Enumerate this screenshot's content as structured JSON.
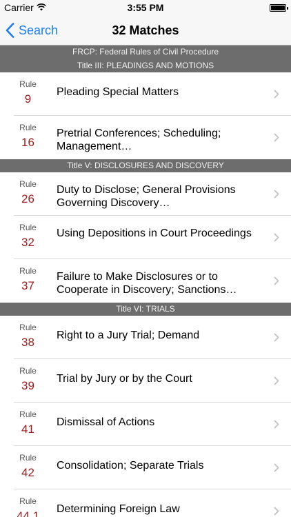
{
  "status_bar": {
    "carrier": "Carrier",
    "time": "3:55 PM",
    "battery_level": 1.0
  },
  "nav": {
    "back_label": "Search",
    "title": "32 Matches"
  },
  "code_header": "FRCP: Federal Rules of Civil Procedure",
  "sections": [
    {
      "title": "Title III: PLEADINGS AND MOTIONS",
      "rows": [
        {
          "rule_label": "Rule",
          "number": "9",
          "title": "Pleading Special Matters"
        },
        {
          "rule_label": "Rule",
          "number": "16",
          "title": "Pretrial Conferences; Scheduling; Management…"
        }
      ]
    },
    {
      "title": "Title V: DISCLOSURES AND DISCOVERY",
      "rows": [
        {
          "rule_label": "Rule",
          "number": "26",
          "title": "Duty to Disclose; General Provisions Governing Discovery…"
        },
        {
          "rule_label": "Rule",
          "number": "32",
          "title": "Using Depositions in Court Proceedings"
        },
        {
          "rule_label": "Rule",
          "number": "37",
          "title": "Failure to Make Disclosures or to Cooperate in Discovery; Sanctions…"
        }
      ]
    },
    {
      "title": "Title VI: TRIALS",
      "rows": [
        {
          "rule_label": "Rule",
          "number": "38",
          "title": "Right to a Jury Trial; Demand"
        },
        {
          "rule_label": "Rule",
          "number": "39",
          "title": "Trial by Jury or by the Court"
        },
        {
          "rule_label": "Rule",
          "number": "41",
          "title": "Dismissal of Actions"
        },
        {
          "rule_label": "Rule",
          "number": "42",
          "title": "Consolidation; Separate Trials"
        },
        {
          "rule_label": "Rule",
          "number": "44.1",
          "title": "Determining Foreign Law"
        }
      ]
    }
  ],
  "colors": {
    "accent": "#1a7cf5",
    "rule_number": "#9b1c1c",
    "section_bg": "#6d6d6d"
  },
  "icons": {
    "back": "chevron-left-icon",
    "disclosure": "chevron-right-icon",
    "wifi": "wifi-icon",
    "battery": "battery-icon"
  }
}
